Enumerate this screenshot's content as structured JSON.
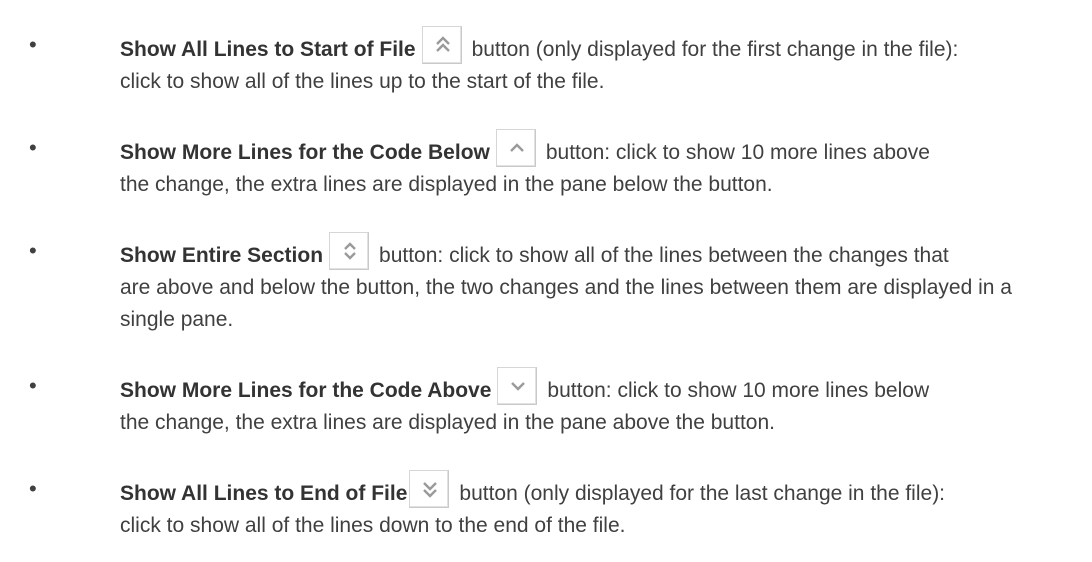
{
  "items": [
    {
      "title": "Show All Lines to Start of File",
      "icon": "double-chevron-up-icon",
      "desc_line1": "button (only displayed for the first change in the file):",
      "desc_rest": "click to show all of the lines up to the start of the file."
    },
    {
      "title": "Show More Lines for the Code Below",
      "icon": "chevron-up-icon",
      "desc_line1": "button: click to show 10 more lines above",
      "desc_rest": "the change, the extra lines are displayed in the pane below the button."
    },
    {
      "title": "Show Entire Section",
      "icon": "expand-vertical-icon",
      "desc_line1": "button: click to show all of the lines between the changes that",
      "desc_rest": "are above and below the button, the two changes and the lines between them are displayed in a single pane."
    },
    {
      "title": "Show More Lines for the Code Above",
      "icon": "chevron-down-icon",
      "desc_line1": "button: click to show 10 more lines below",
      "desc_rest": "the change, the extra lines are displayed in the pane above the button."
    },
    {
      "title": "Show All Lines to End of File",
      "icon": "double-chevron-down-icon",
      "desc_line1": "button (only displayed for the last change in the file):",
      "desc_rest": "click to show all of the lines down to the end of the file."
    }
  ],
  "colors": {
    "text": "#404040",
    "icon": "#9a9a9a",
    "button_border": "#c9c9c9"
  }
}
